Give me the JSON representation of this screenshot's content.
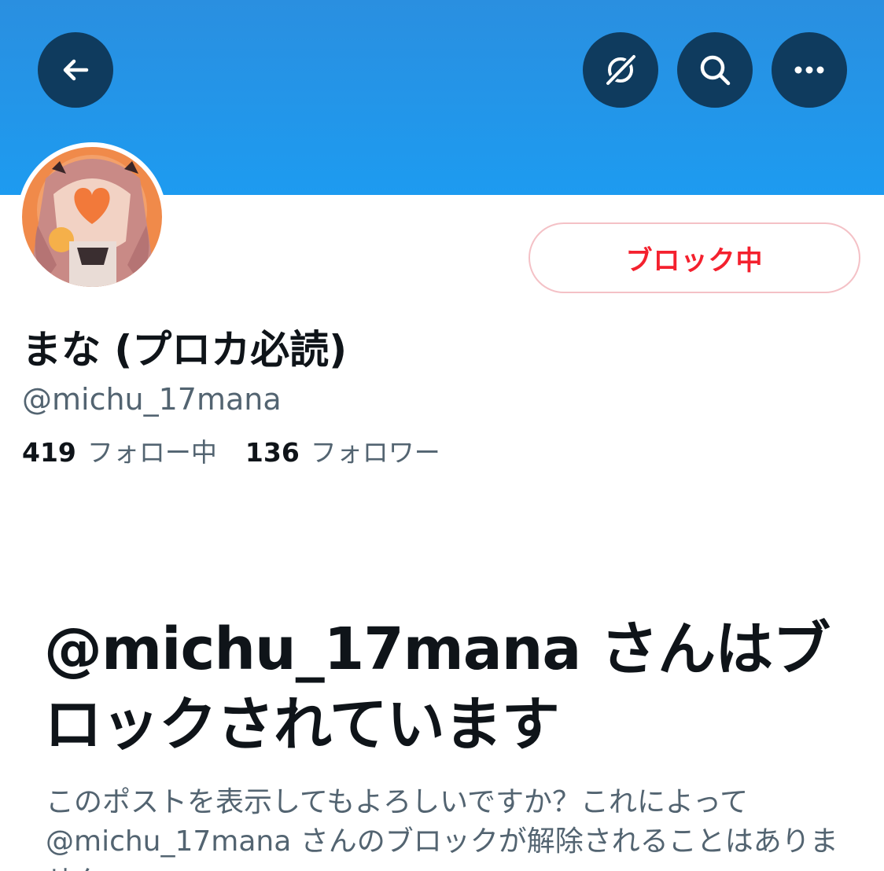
{
  "header": {
    "back_icon": "arrow-left-icon",
    "grok_icon": "grok-icon",
    "search_icon": "search-icon",
    "more_icon": "more-horizontal-icon",
    "banner_color": "#1d9bf0",
    "button_bg": "#0f3b5e"
  },
  "profile": {
    "display_name": "まな (プロカ必読)",
    "handle": "@michu_17mana",
    "following_count": "419",
    "following_label": "フォロー中",
    "followers_count": "136",
    "followers_label": "フォロワー",
    "block_button_label": "ブロック中",
    "block_color": "#f4212e"
  },
  "blocked_notice": {
    "title": "@michu_17mana さんはブロックされています",
    "description": "このポストを表示してもよろしいですか？これによって@michu_17mana さんのブロックが解除されることはありません。"
  }
}
